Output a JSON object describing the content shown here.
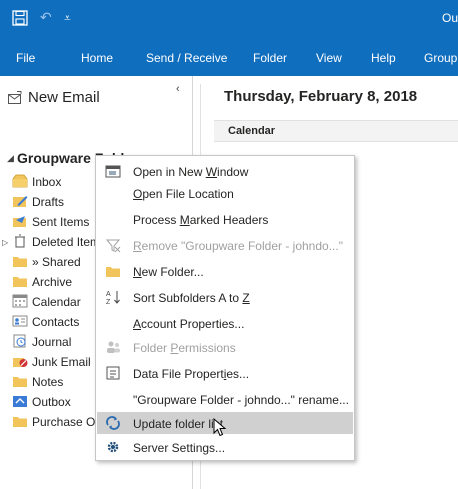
{
  "title_bar": {
    "app_title_fragment": "Ou",
    "accent": "#106ebe"
  },
  "ribbon_tabs": [
    "File",
    "Home",
    "Send / Receive",
    "Folder",
    "View",
    "Help",
    "Group"
  ],
  "nav": {
    "new_email": "New Email",
    "group_header": "Groupware Folder",
    "folders": [
      {
        "label": "Inbox",
        "icon": "inbox-icon"
      },
      {
        "label": "Drafts",
        "icon": "drafts-icon"
      },
      {
        "label": "Sent Items",
        "icon": "sent-icon"
      },
      {
        "label": "Deleted Items",
        "icon": "trash-icon"
      },
      {
        "label": "» Shared",
        "icon": "folder-icon"
      },
      {
        "label": "Archive",
        "icon": "folder-icon"
      },
      {
        "label": "Calendar",
        "icon": "calendar-icon"
      },
      {
        "label": "Contacts",
        "icon": "contacts-icon"
      },
      {
        "label": "Journal",
        "icon": "journal-icon"
      },
      {
        "label": "Junk Email",
        "icon": "junk-icon"
      },
      {
        "label": "Notes",
        "icon": "notes-icon"
      },
      {
        "label": "Outbox",
        "icon": "outbox-icon"
      },
      {
        "label": "Purchase Orders",
        "icon": "folder-icon"
      }
    ]
  },
  "main": {
    "date_heading": "Thursday, February 8, 2018",
    "calendar_label": "Calendar"
  },
  "context_menu": {
    "items": [
      {
        "label": "Open in New Window",
        "icon": "new-window-icon",
        "disabled": false
      },
      {
        "label": "Open File Location",
        "icon": "",
        "disabled": false
      },
      {
        "label": "Process Marked Headers",
        "icon": "",
        "disabled": false
      },
      {
        "label": "Remove \"Groupware Folder - johndo...\"",
        "icon": "remove-icon",
        "disabled": true
      },
      {
        "label": "New Folder...",
        "icon": "new-folder-icon",
        "disabled": false
      },
      {
        "label": "Sort Subfolders A to Z",
        "icon": "sort-az-icon",
        "disabled": false
      },
      {
        "label": "Account Properties...",
        "icon": "",
        "disabled": false
      },
      {
        "label": "Folder Permissions",
        "icon": "permissions-icon",
        "disabled": true
      },
      {
        "label": "Data File Properties...",
        "icon": "data-file-icon",
        "disabled": false
      },
      {
        "label": "\"Groupware Folder - johndo...\" rename...",
        "icon": "",
        "disabled": false
      },
      {
        "label": "Update folder list",
        "icon": "refresh-icon",
        "disabled": false,
        "highlighted": true
      },
      {
        "label": "Server Settings...",
        "icon": "gear-icon",
        "disabled": false
      }
    ]
  }
}
